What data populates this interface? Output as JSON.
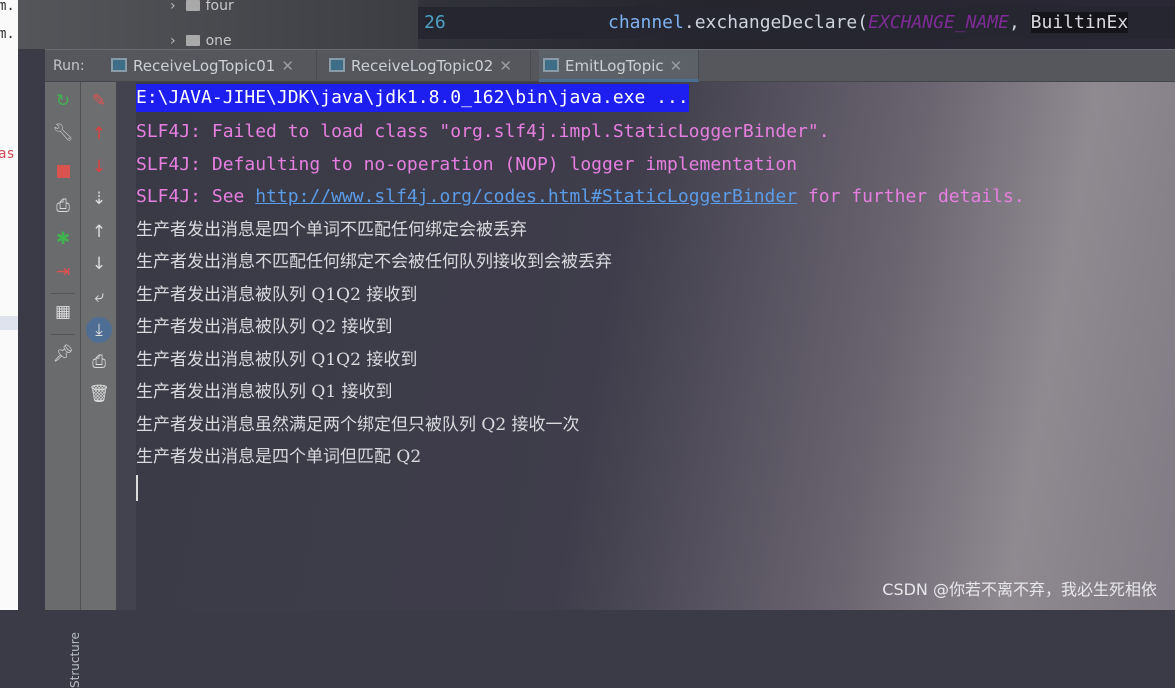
{
  "left_strip": {
    "lines": [
      "m.",
      "m.",
      "as"
    ]
  },
  "project_tree": {
    "items": [
      {
        "label": "four"
      },
      {
        "label": "one"
      }
    ]
  },
  "editor": {
    "line_number": "26",
    "code": {
      "receiver": "channel",
      "method": ".exchangeDeclare(",
      "constant": "EXCHANGE_NAME",
      "sep": ", ",
      "next": "BuiltinEx"
    }
  },
  "run_panel": {
    "label": "Run:",
    "tabs": [
      {
        "label": "ReceiveLogTopic01",
        "active": false
      },
      {
        "label": "ReceiveLogTopic02",
        "active": false
      },
      {
        "label": "EmitLogTopic",
        "active": true
      }
    ]
  },
  "toolbar_left": [
    "rerun-icon",
    "wrench-icon",
    "stop-icon",
    "camera-icon",
    "debug-attach-icon",
    "login-icon",
    "layout-icon",
    "pin-icon"
  ],
  "toolbar_right": [
    "clear-icon",
    "up-red-icon",
    "down-red-icon",
    "sort-icon",
    "up-icon",
    "down-icon",
    "soft-wrap-icon",
    "scroll-to-end-icon",
    "print-icon",
    "trash-icon"
  ],
  "structure_label": "Structure",
  "console": {
    "command": "E:\\JAVA-JIHE\\JDK\\java\\jdk1.8.0_162\\bin\\java.exe ...",
    "warn1": "SLF4J: Failed to load class \"org.slf4j.impl.StaticLoggerBinder\".",
    "warn2": "SLF4J: Defaulting to no-operation (NOP) logger implementation",
    "warn3_prefix": "SLF4J: See ",
    "warn3_link": "http://www.slf4j.org/codes.html#StaticLoggerBinder",
    "warn3_suffix": " for further details.",
    "output": [
      "生产者发出消息是四个单词不匹配任何绑定会被丢弃",
      "生产者发出消息不匹配任何绑定不会被任何队列接收到会被丢弃",
      "生产者发出消息被队列 Q1Q2 接收到",
      "生产者发出消息被队列 Q2 接收到",
      "生产者发出消息被队列 Q1Q2 接收到",
      "生产者发出消息被队列 Q1 接收到",
      "生产者发出消息虽然满足两个绑定但只被队列 Q2 接收一次",
      "生产者发出消息是四个单词但匹配 Q2"
    ]
  },
  "watermark": "CSDN @你若不离不弃，我必生死相依",
  "colors": {
    "highlight": "#1c1ff0",
    "warning": "#e77fe0",
    "link": "#5b9ce8"
  }
}
